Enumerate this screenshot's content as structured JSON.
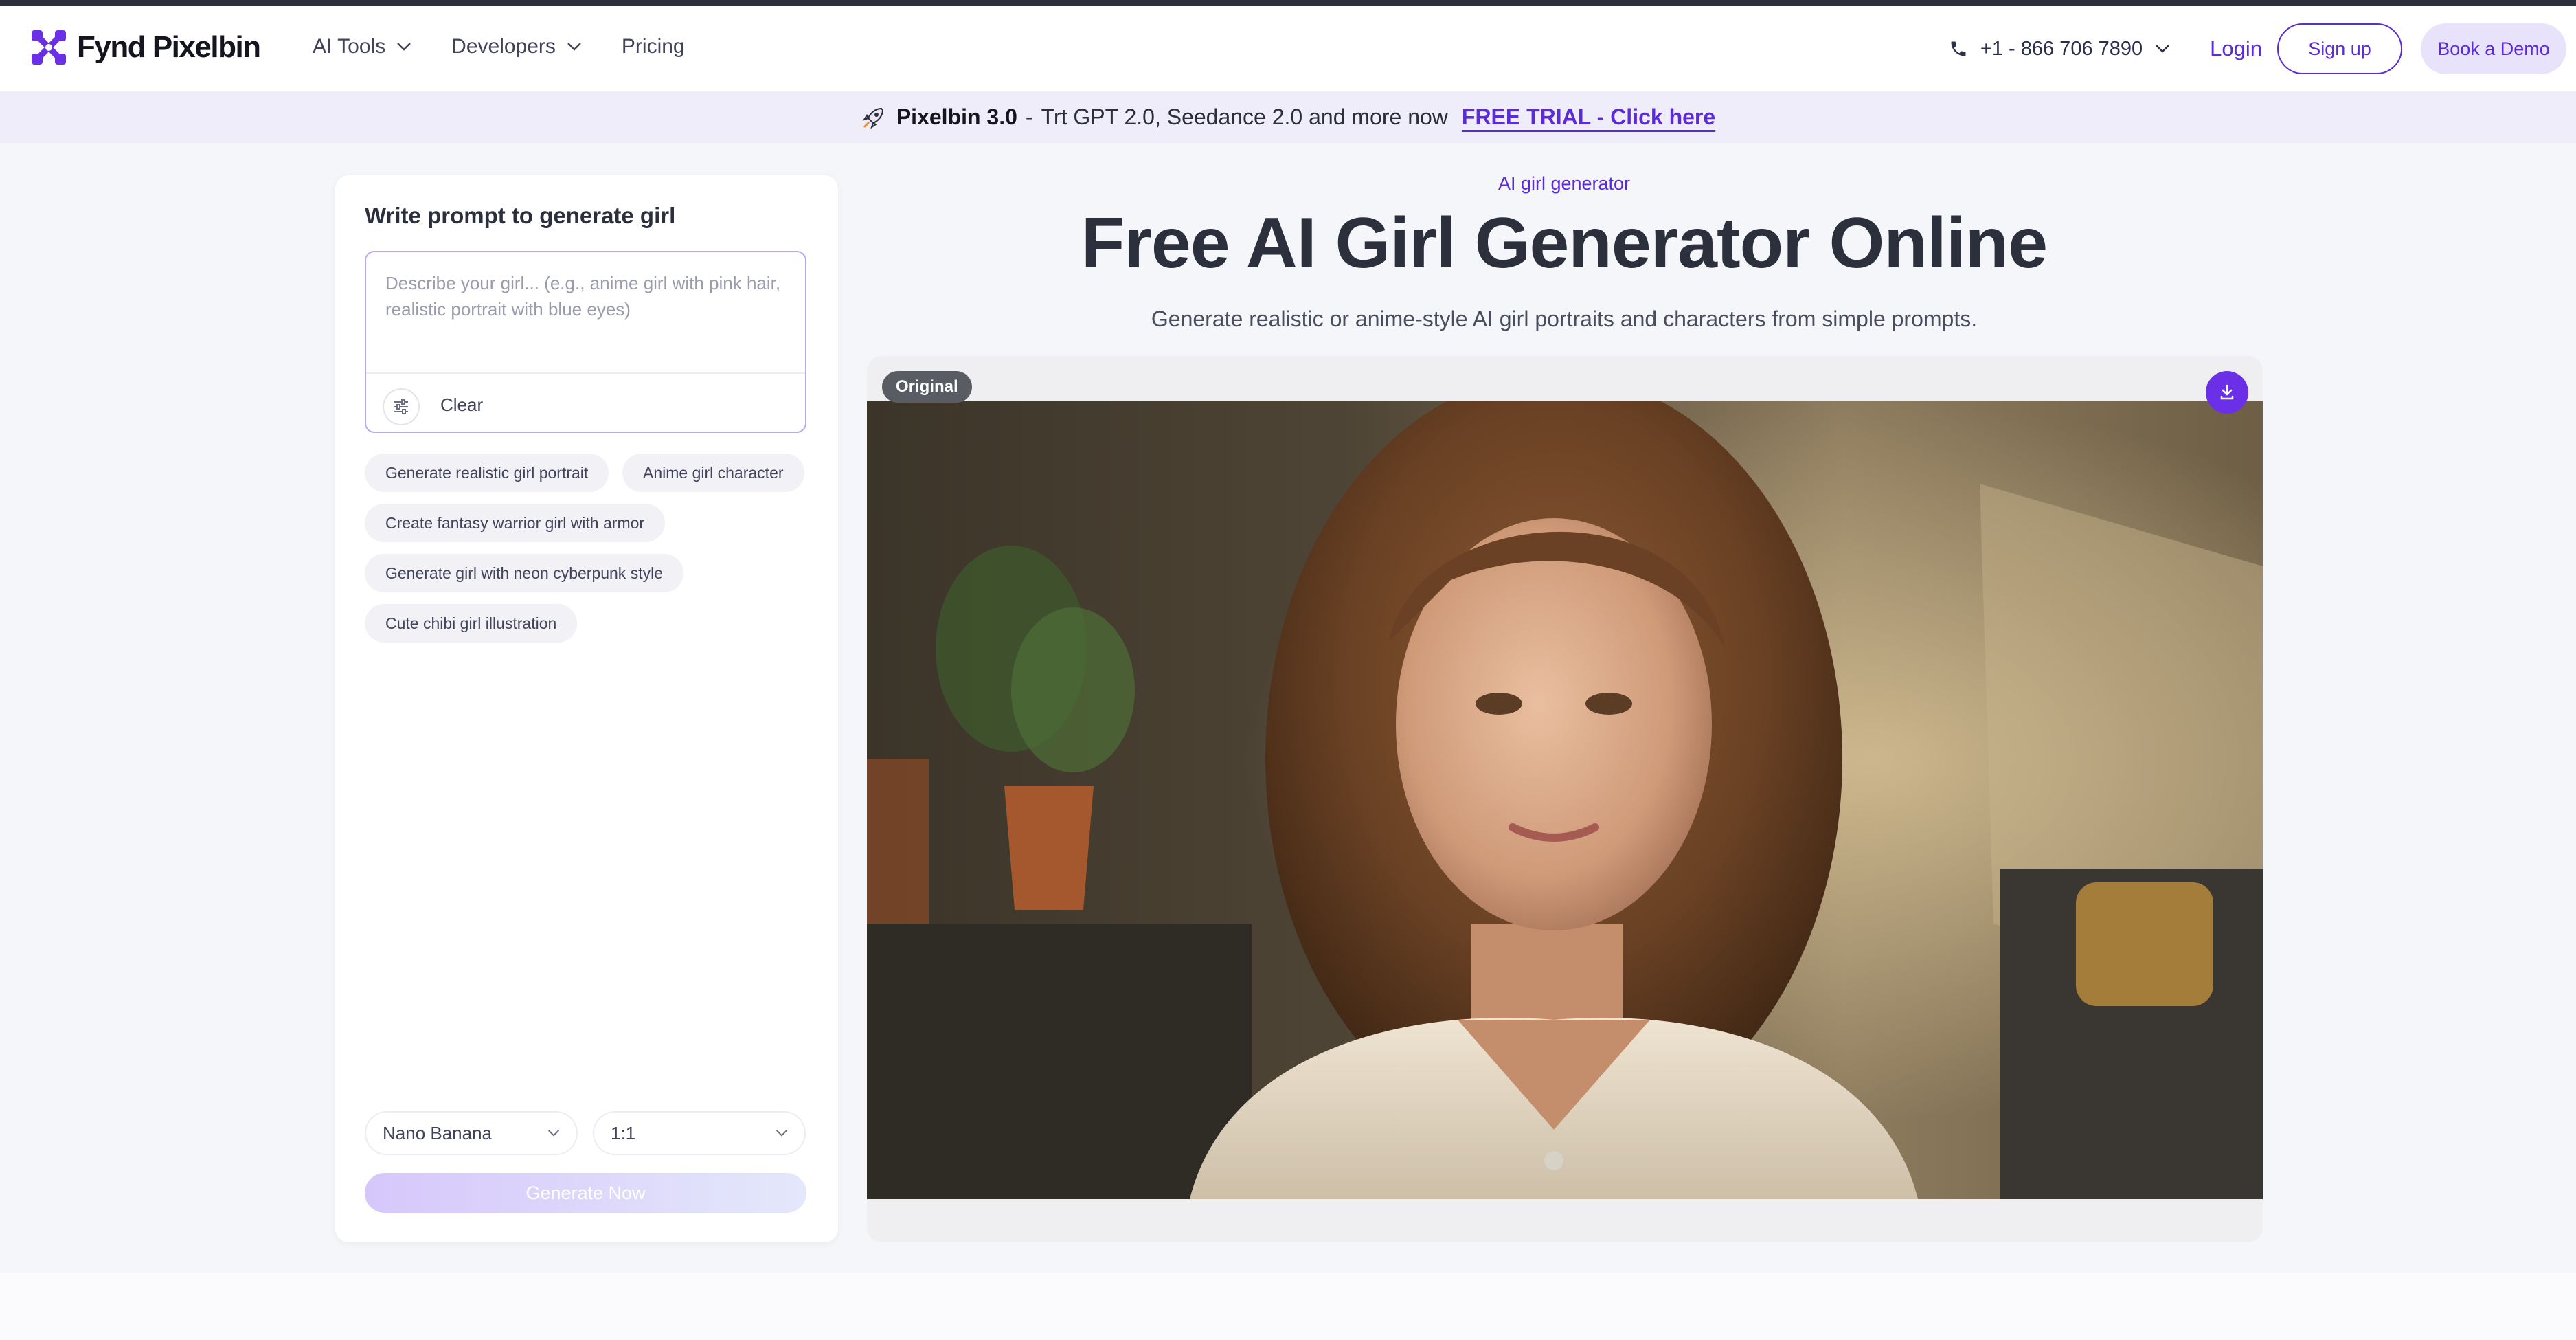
{
  "brand": {
    "name": "Fynd Pixelbin",
    "accent": "#5b2bd8"
  },
  "nav": {
    "items": [
      {
        "label": "AI Tools",
        "has_dropdown": true
      },
      {
        "label": "Developers",
        "has_dropdown": true
      },
      {
        "label": "Pricing",
        "has_dropdown": false
      }
    ],
    "phone": "+1 - 866 706 7890",
    "login": "Login",
    "signup": "Sign up",
    "demo": "Book a Demo"
  },
  "banner": {
    "icon": "rocket-icon",
    "product": "Pixelbin 3.0",
    "separator": "-",
    "text": "Trt GPT 2.0, Seedance 2.0 and more now",
    "cta": "FREE TRIAL - Click here"
  },
  "panel": {
    "title": "Write prompt to generate girl",
    "prompt_placeholder": "Describe your girl... (e.g., anime girl with pink hair, realistic portrait with blue eyes)",
    "prompt_value": "",
    "clear_label": "Clear",
    "suggestions": [
      "Generate realistic girl portrait",
      "Anime girl character",
      "Create fantasy warrior girl with armor",
      "Generate girl with neon cyberpunk style",
      "Cute chibi girl illustration"
    ],
    "model": "Nano Banana",
    "aspect_ratio": "1:1",
    "generate_label": "Generate Now"
  },
  "hero": {
    "eyebrow": "AI girl generator",
    "title": "Free AI Girl Generator Online",
    "subtitle": "Generate realistic or anime-style AI girl portraits and characters from simple prompts."
  },
  "preview": {
    "badge": "Original"
  }
}
